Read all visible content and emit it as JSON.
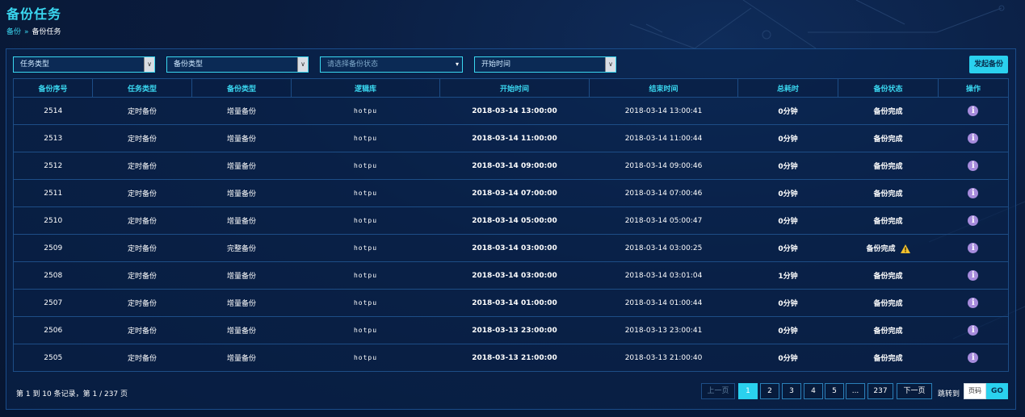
{
  "page": {
    "title": "备份任务"
  },
  "breadcrumb": {
    "home": "备份",
    "current": "备份任务"
  },
  "filters": {
    "task_type": "任务类型",
    "backup_type": "备份类型",
    "backup_status_placeholder": "请选择备份状态",
    "start_time": "开始时间"
  },
  "actions": {
    "start_backup": "发起备份"
  },
  "table": {
    "headers": [
      "备份序号",
      "任务类型",
      "备份类型",
      "逻辑库",
      "开始时间",
      "结束时间",
      "总耗时",
      "备份状态",
      "操作"
    ],
    "rows": [
      {
        "id": "2514",
        "task_type": "定时备份",
        "backup_type": "增量备份",
        "db": "hotpu",
        "start": "2018-03-14 13:00:00",
        "end": "2018-03-14 13:00:41",
        "duration": "0分钟",
        "status": "备份完成",
        "warning": false
      },
      {
        "id": "2513",
        "task_type": "定时备份",
        "backup_type": "增量备份",
        "db": "hotpu",
        "start": "2018-03-14 11:00:00",
        "end": "2018-03-14 11:00:44",
        "duration": "0分钟",
        "status": "备份完成",
        "warning": false
      },
      {
        "id": "2512",
        "task_type": "定时备份",
        "backup_type": "增量备份",
        "db": "hotpu",
        "start": "2018-03-14 09:00:00",
        "end": "2018-03-14 09:00:46",
        "duration": "0分钟",
        "status": "备份完成",
        "warning": false
      },
      {
        "id": "2511",
        "task_type": "定时备份",
        "backup_type": "增量备份",
        "db": "hotpu",
        "start": "2018-03-14 07:00:00",
        "end": "2018-03-14 07:00:46",
        "duration": "0分钟",
        "status": "备份完成",
        "warning": false
      },
      {
        "id": "2510",
        "task_type": "定时备份",
        "backup_type": "增量备份",
        "db": "hotpu",
        "start": "2018-03-14 05:00:00",
        "end": "2018-03-14 05:00:47",
        "duration": "0分钟",
        "status": "备份完成",
        "warning": false
      },
      {
        "id": "2509",
        "task_type": "定时备份",
        "backup_type": "完整备份",
        "db": "hotpu",
        "start": "2018-03-14 03:00:00",
        "end": "2018-03-14 03:00:25",
        "duration": "0分钟",
        "status": "备份完成",
        "warning": true
      },
      {
        "id": "2508",
        "task_type": "定时备份",
        "backup_type": "增量备份",
        "db": "hotpu",
        "start": "2018-03-14 03:00:00",
        "end": "2018-03-14 03:01:04",
        "duration": "1分钟",
        "status": "备份完成",
        "warning": false
      },
      {
        "id": "2507",
        "task_type": "定时备份",
        "backup_type": "增量备份",
        "db": "hotpu",
        "start": "2018-03-14 01:00:00",
        "end": "2018-03-14 01:00:44",
        "duration": "0分钟",
        "status": "备份完成",
        "warning": false
      },
      {
        "id": "2506",
        "task_type": "定时备份",
        "backup_type": "增量备份",
        "db": "hotpu",
        "start": "2018-03-13 23:00:00",
        "end": "2018-03-13 23:00:41",
        "duration": "0分钟",
        "status": "备份完成",
        "warning": false
      },
      {
        "id": "2505",
        "task_type": "定时备份",
        "backup_type": "增量备份",
        "db": "hotpu",
        "start": "2018-03-13 21:00:00",
        "end": "2018-03-13 21:00:40",
        "duration": "0分钟",
        "status": "备份完成",
        "warning": false
      }
    ]
  },
  "footer": {
    "summary": "第 1 到 10 条记录，第 1 / 237 页",
    "prev": "上一页",
    "pages": [
      "1",
      "2",
      "3",
      "4",
      "5",
      "...",
      "237"
    ],
    "next": "下一页",
    "jump_label": "跳转到",
    "jump_placeholder": "页码",
    "go": "GO"
  },
  "colors": {
    "accent": "#2ad1ee",
    "db_text": "#4de07a",
    "info": "#a68bdc",
    "warning": "#f2c12e"
  },
  "icons": {
    "row_action": "info-icon",
    "warning": "warning-icon",
    "dropdown": "chevron-down-icon"
  }
}
